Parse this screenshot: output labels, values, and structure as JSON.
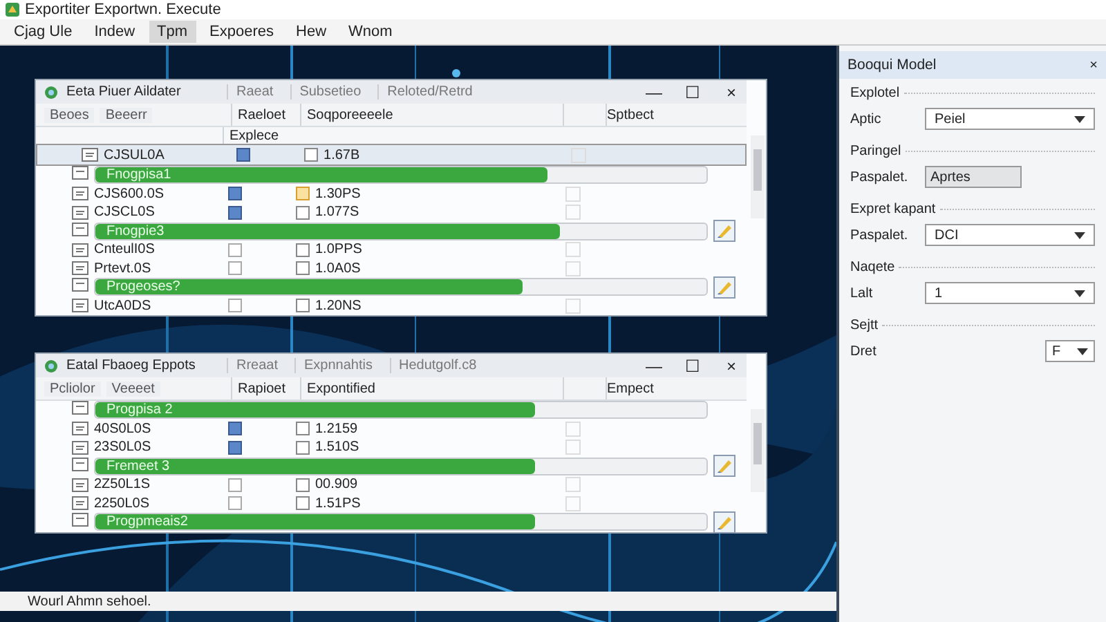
{
  "window": {
    "title": "Exportiter Exportwn. Execute"
  },
  "menu": [
    {
      "label": "Cjag Ule",
      "selected": false
    },
    {
      "label": "Indew",
      "selected": false
    },
    {
      "label": "Tpm",
      "selected": true
    },
    {
      "label": "Expoeres",
      "selected": false
    },
    {
      "label": "Hew",
      "selected": false
    },
    {
      "label": "Wnom",
      "selected": false
    }
  ],
  "panels": [
    {
      "title": "Eeta Piuer Aildater",
      "tabs": [
        "Raeat",
        "Subsetieo",
        "Reloted/Retrd"
      ],
      "controls": [
        "—",
        "☐",
        "×"
      ],
      "toolbar": [
        "Beoes",
        "Beeerr"
      ],
      "headers": [
        "Raeloet",
        "Soqporeeeele",
        "Sptbect"
      ],
      "subheader": "Explece",
      "rows": [
        {
          "kind": "file",
          "name": "CJSUL0A",
          "flag": true,
          "warning": false,
          "value": "1.67B",
          "selected": true
        },
        {
          "kind": "progress",
          "label": "Fnogpisa1",
          "level": 0.74,
          "action": false
        },
        {
          "kind": "file",
          "name": "CJS600.0S",
          "flag": true,
          "warning": true,
          "value": "1.30PS",
          "selected": false
        },
        {
          "kind": "file",
          "name": "CJSCL0S",
          "flag": true,
          "warning": false,
          "value": "1.077S",
          "selected": false
        },
        {
          "kind": "progress",
          "label": "Fnogpie3",
          "level": 0.76,
          "action": true
        },
        {
          "kind": "file",
          "name": "CnteulI0S",
          "flag": false,
          "warning": false,
          "value": "1.0PPS",
          "selected": false
        },
        {
          "kind": "file",
          "name": "Prtevt.0S",
          "flag": false,
          "warning": false,
          "value": "1.0A0S",
          "selected": false
        },
        {
          "kind": "progress",
          "label": "Progeoses?",
          "level": 0.7,
          "action": true
        },
        {
          "kind": "file",
          "name": "UtcA0DS",
          "flag": false,
          "warning": false,
          "value": "1.20NS",
          "selected": false
        }
      ]
    },
    {
      "title": "Eatal Fbaoeg Eppots",
      "tabs": [
        "Rreaat",
        "Expnnahtis",
        "Hedutgolf.c8"
      ],
      "controls": [
        "—",
        "☐",
        "×"
      ],
      "toolbar": [
        "Pcliolor",
        "Veeeet"
      ],
      "headers": [
        "Rapioet",
        "Expontified",
        "Empect"
      ],
      "rows": [
        {
          "kind": "progress",
          "label": "Progpisa 2",
          "level": 0.72,
          "action": false
        },
        {
          "kind": "file",
          "name": "40S0L0S",
          "flag": true,
          "warning": false,
          "value": "1.2159",
          "selected": false
        },
        {
          "kind": "file",
          "name": "23S0L0S",
          "flag": true,
          "warning": false,
          "value": "1.510S",
          "selected": false
        },
        {
          "kind": "progress",
          "label": "Fremeet 3",
          "level": 0.72,
          "action": true
        },
        {
          "kind": "file",
          "name": "2Z50L1S",
          "flag": false,
          "warning": false,
          "value": "00.909",
          "selected": false
        },
        {
          "kind": "file",
          "name": "2250L0S",
          "flag": false,
          "warning": false,
          "value": "1.51PS",
          "selected": false
        },
        {
          "kind": "progress",
          "label": "Progpmeais2",
          "level": 0.72,
          "action": true
        }
      ]
    }
  ],
  "side": {
    "title": "Booqui Model",
    "close": "×",
    "sections": [
      {
        "heading": "Explotel",
        "label": "Aptic",
        "kind": "select",
        "value": "Peiel"
      },
      {
        "heading": "Paringel",
        "label": "Paspalet.",
        "kind": "text",
        "value": "Aprtes"
      },
      {
        "heading": "Expret kapant",
        "label": "Paspalet.",
        "kind": "select",
        "value": "DCI"
      },
      {
        "heading": "Naqete",
        "label": "Lalt",
        "kind": "select",
        "value": "1"
      },
      {
        "heading": "Sejtt",
        "label": "Dret",
        "kind": "small",
        "value": "F"
      }
    ]
  },
  "status_bar": "Wourl Ahmn sehoel."
}
